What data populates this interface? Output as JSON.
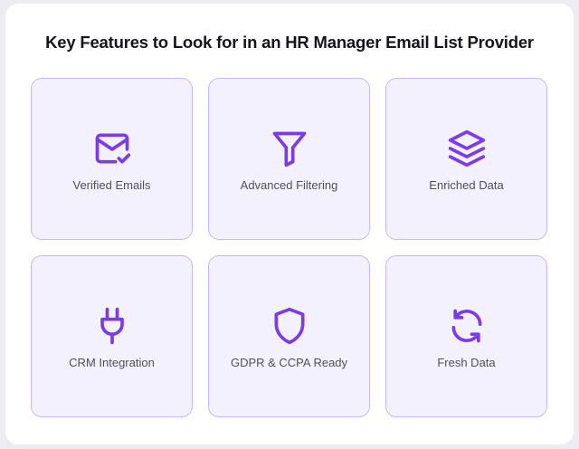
{
  "title": "Key Features to Look for in an HR Manager Email List Provider",
  "colors": {
    "accent": "#7c3aed",
    "tile_background": "#f4f1fe",
    "tile_border": "#c7b9f7"
  },
  "features": [
    {
      "label": "Verified Emails",
      "icon": "mail-check-icon"
    },
    {
      "label": "Advanced Filtering",
      "icon": "filter-icon"
    },
    {
      "label": "Enriched Data",
      "icon": "layers-icon"
    },
    {
      "label": "CRM Integration",
      "icon": "plug-icon"
    },
    {
      "label": "GDPR & CCPA Ready",
      "icon": "shield-icon"
    },
    {
      "label": "Fresh Data",
      "icon": "refresh-icon"
    }
  ]
}
